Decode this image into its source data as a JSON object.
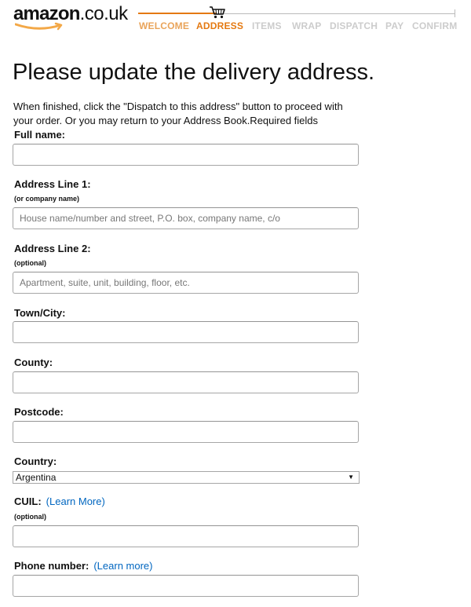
{
  "logo": {
    "brand": "amazon",
    "tld": ".co.uk"
  },
  "checkout_steps": [
    {
      "label": "WELCOME",
      "state": "done"
    },
    {
      "label": "ADDRESS",
      "state": "active"
    },
    {
      "label": "ITEMS",
      "state": "pending"
    },
    {
      "label": "WRAP",
      "state": "pending"
    },
    {
      "label": "DISPATCH",
      "state": "pending"
    },
    {
      "label": "PAY",
      "state": "pending"
    },
    {
      "label": "CONFIRM",
      "state": "pending"
    }
  ],
  "page": {
    "title": "Please update the delivery address.",
    "intro": "When finished, click the \"Dispatch to this address\" button to proceed with your order. Or you may return to your Address Book.Required fields"
  },
  "form": {
    "full_name": {
      "label": "Full name:",
      "value": ""
    },
    "address_line_1": {
      "label": "Address Line 1:",
      "note": "(or company name)",
      "placeholder": "House name/number and street, P.O. box, company name, c/o",
      "value": ""
    },
    "address_line_2": {
      "label": "Address Line 2:",
      "note": "(optional)",
      "placeholder": "Apartment, suite, unit, building, floor, etc.",
      "value": ""
    },
    "town_city": {
      "label": "Town/City:",
      "value": ""
    },
    "county": {
      "label": "County:",
      "value": ""
    },
    "postcode": {
      "label": "Postcode:",
      "value": ""
    },
    "country": {
      "label": "Country:",
      "selected": "Argentina"
    },
    "cuil": {
      "label": "CUIL:",
      "learn_more": "(Learn More)",
      "note": "(optional)",
      "value": ""
    },
    "phone": {
      "label": "Phone number:",
      "learn_more": "(Learn more)",
      "value": ""
    }
  },
  "colors": {
    "accent": "#e47911",
    "link": "#0066c0",
    "step_pending": "#cccccc"
  }
}
